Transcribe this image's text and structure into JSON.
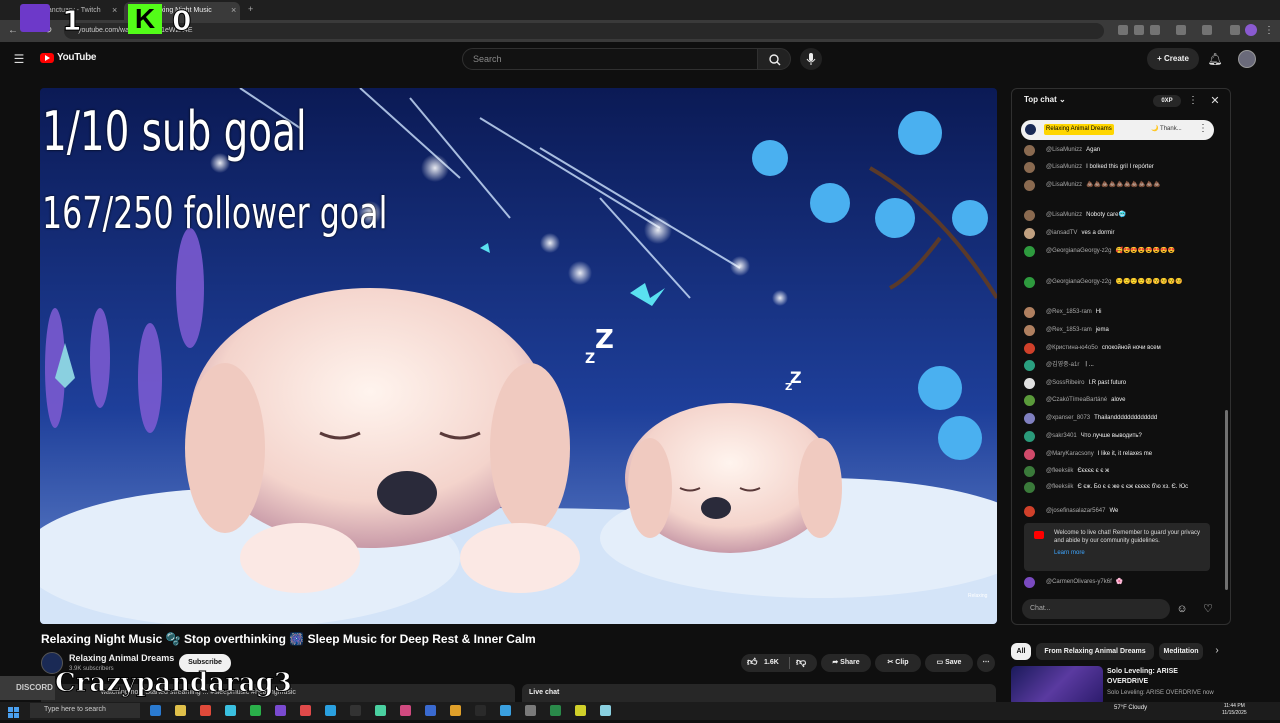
{
  "browser": {
    "tabs": [
      {
        "label": "veupSanctuary - Twitch",
        "close": "×"
      },
      {
        "label": "Relaxing Night Music",
        "close": "×"
      }
    ],
    "new_tab": "+",
    "url": "youtube.com/watch?v=...Q1eWzH4E"
  },
  "overlay": {
    "twitch_count": "1",
    "kick_logo": "K",
    "kick_count": "0",
    "sub_goal": "1/10 sub goal",
    "follower_goal": "167/250 follower goal",
    "streamer_name": "Crazypandarag3",
    "discord_label": "DISCORD"
  },
  "header": {
    "logo": "YouTube",
    "search_placeholder": "Search",
    "create_label": "+ Create"
  },
  "video": {
    "title": "Relaxing Night Music 🫧 Stop overthinking 🎆 Sleep Music for Deep Rest & Inner Calm",
    "watermark": "Relaxing",
    "channel_name": "Relaxing Animal Dreams",
    "subscribers": "3.9K subscribers",
    "subscribe_label": "Subscribe",
    "likes": "1.6K",
    "share_label": "Share",
    "clip_label": "Clip",
    "save_label": "Save",
    "description_snippet": "watching now  Started streaming ... #sleepmusic #healingmusic",
    "live_chat_label": "Live chat"
  },
  "chat": {
    "header": "Top chat",
    "xp": "0XP",
    "pinned_author": "Relaxing Animal Dreams",
    "pinned_text": "🌙 Thank...",
    "messages": [
      {
        "author": "@LisaMunizz",
        "text": "Agan",
        "color": "#8a6a50"
      },
      {
        "author": "@LisaMunizz",
        "text": "I bolked this gril I repórter",
        "color": "#8a6a50"
      },
      {
        "author": "@LisaMunizz",
        "text": "💩💩💩💩💩💩💩💩💩💩",
        "color": "#8a6a50"
      },
      {
        "author": "@LisaMunizz",
        "text": "Noboty care🥶",
        "color": "#8a6a50"
      },
      {
        "author": "@iansadTV",
        "text": "ves a dormir",
        "color": "#c0a080"
      },
      {
        "author": "@GeorgianaGeorgy-z2g",
        "text": "🥰😍😍😍😍😍😍😍",
        "color": "#2e9a3e"
      },
      {
        "author": "@GeorgianaGeorgy-z2g",
        "text": "😌😌😌😌😚😚😚😚😚",
        "color": "#2e9a3e"
      },
      {
        "author": "@Rex_1853-ram",
        "text": "Hi",
        "color": "#b08060"
      },
      {
        "author": "@Rex_1853-ram",
        "text": "jema",
        "color": "#b08060"
      },
      {
        "author": "@Кристина-ю4о5о",
        "text": "спокойной ночи всем",
        "color": "#d0402a"
      },
      {
        "author": "@김영중-a1r",
        "text": "ㅣ...",
        "color": "#2aa080"
      },
      {
        "author": "@SossRibeiro",
        "text": "I.R past futuro",
        "color": "#e0e0e0"
      },
      {
        "author": "@CzakóTímeaBartáné",
        "text": "alove",
        "color": "#5a9a3a"
      },
      {
        "author": "@xpanser_8073",
        "text": "Thailanddddddddddddd",
        "color": "#8080c0"
      },
      {
        "author": "@sakr3401",
        "text": "Что лучше выводить?",
        "color": "#2a9a7a"
      },
      {
        "author": "@MaryKaracsony",
        "text": "I like it, it relaxes me",
        "color": "#d04a6a"
      },
      {
        "author": "@fleeksiik",
        "text": "Єєєєє є є ж",
        "color": "#3a7a3a"
      },
      {
        "author": "@fleeksiik",
        "text": "Є єж. Бо є є же є єж єєєєє б'ю хз. Є. Юс",
        "color": "#3a7a3a"
      },
      {
        "author": "@josefinasalazar5647",
        "text": "We",
        "color": "#d0402a"
      }
    ],
    "welcome_text": "Welcome to live chat! Remember to guard your privacy and abide by our community guidelines.",
    "learn_more": "Learn more",
    "last_message": {
      "author": "@CarmenOlivares-y7k6f",
      "text": "🌸",
      "color": "#7a4ac0"
    },
    "input_placeholder": "Chat..."
  },
  "related": {
    "chips": [
      "All",
      "From Relaxing Animal Dreams",
      "Meditation"
    ],
    "video_title": "Solo Leveling: ARISE OVERDRIVE",
    "video_sub": "Solo Leveling: ARISE OVERDRIVE now"
  },
  "taskbar": {
    "search_placeholder": "Type here to search",
    "weather": "57°F  Cloudy",
    "time": "11:44 PM",
    "date": "11/15/2025"
  },
  "icons": [
    "twitch-icon",
    "kick-icon",
    "menu-icon",
    "youtube-logo-icon",
    "search-icon",
    "mic-icon",
    "bell-icon",
    "avatar",
    "like-icon",
    "dislike-icon",
    "share-icon",
    "clip-icon",
    "save-icon",
    "more-icon",
    "heart-icon",
    "smiley-icon",
    "close-icon",
    "chevron-right-icon",
    "windows-icon"
  ],
  "colors": {
    "yt_red": "#ff0000",
    "accent_blue": "#3ea6ff",
    "twitch_purple": "#6d39c9",
    "kick_green": "#53fc18"
  }
}
